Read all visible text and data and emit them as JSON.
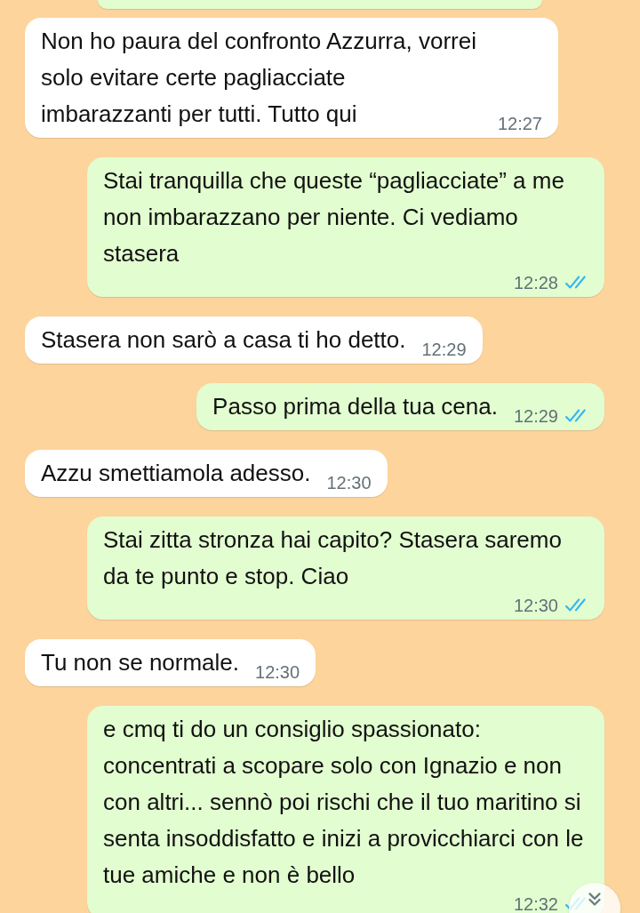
{
  "messages": [
    {
      "kind": "in",
      "text": "Non ho paura del confronto Azzurra, vorrei solo evitare certe pagliacciate imbarazzanti per tutti. Tutto qui",
      "time": "12:27"
    },
    {
      "kind": "out",
      "text": "Stai tranquilla che queste “pagliacciate” a me non imbarazzano per niente. Ci vediamo stasera",
      "time": "12:28",
      "read": true
    },
    {
      "kind": "in",
      "text": "Stasera non sarò a casa ti ho detto.",
      "time": "12:29"
    },
    {
      "kind": "out",
      "text": "Passo prima della tua cena.",
      "time": "12:29",
      "read": true
    },
    {
      "kind": "in",
      "text": "Azzu smettiamola adesso.",
      "time": "12:30"
    },
    {
      "kind": "out",
      "text": "Stai zitta stronza hai capito? Stasera saremo da te punto e stop. Ciao",
      "time": "12:30",
      "read": true
    },
    {
      "kind": "in",
      "text": "Tu non se normale.",
      "time": "12:30"
    },
    {
      "kind": "out",
      "text": "e cmq ti do un consiglio spassionato: concentrati a scopare solo con Ignazio e non  con altri... sennò poi rischi che il tuo maritino si senta insoddisfatto e inizi a provicchiarci con le tue amiche e non è bello",
      "time": "12:32",
      "read": true
    }
  ]
}
